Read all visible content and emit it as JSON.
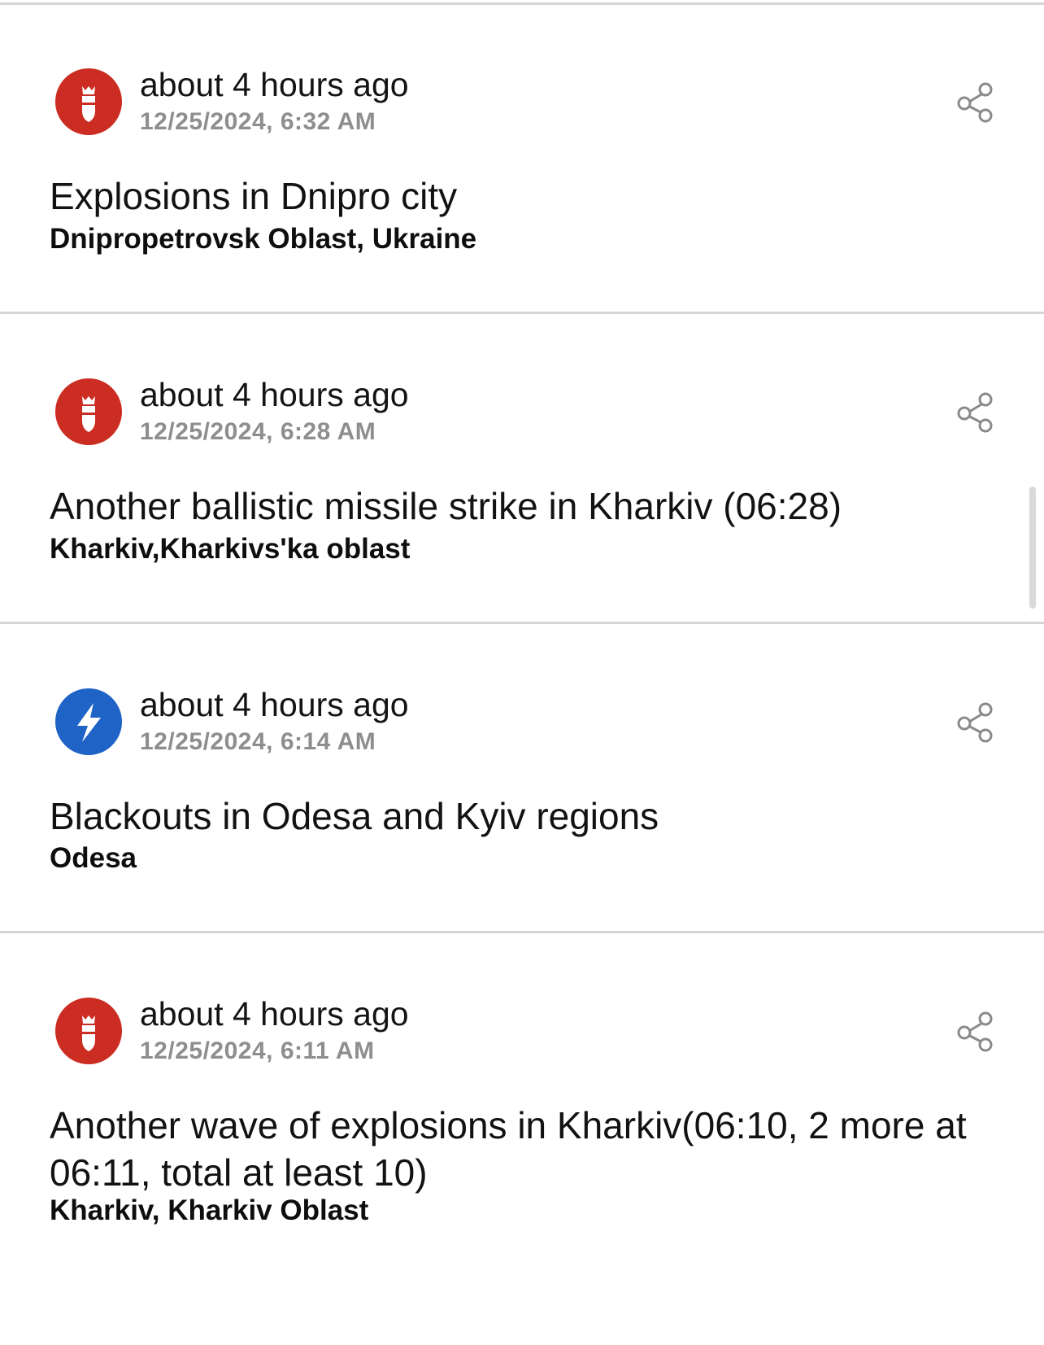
{
  "feed": {
    "items": [
      {
        "category_icon": "bomb-icon",
        "icon_color": "#cc2d22",
        "relative_time": "about 4 hours ago",
        "timestamp": "12/25/2024, 6:32 AM",
        "title": "Explosions in Dnipro city",
        "location": "Dnipropetrovsk Oblast, Ukraine"
      },
      {
        "category_icon": "bomb-icon",
        "icon_color": "#cc2d22",
        "relative_time": "about 4 hours ago",
        "timestamp": "12/25/2024, 6:28 AM",
        "title": "Another ballistic missile strike in Kharkiv (06:28)",
        "location": "Kharkiv,Kharkivs'ka oblast"
      },
      {
        "category_icon": "lightning-bolt-icon",
        "icon_color": "#1f63c6",
        "relative_time": "about 4 hours ago",
        "timestamp": "12/25/2024, 6:14 AM",
        "title": "Blackouts in Odesa and Kyiv regions",
        "location": "Odesa"
      },
      {
        "category_icon": "bomb-icon",
        "icon_color": "#cc2d22",
        "relative_time": "about 4 hours ago",
        "timestamp": "12/25/2024, 6:11 AM",
        "title": "Another wave of explosions in Kharkiv(06:10, 2 more at 06:11, total at least 10)",
        "location": "Kharkiv, Kharkiv Oblast"
      }
    ],
    "share_icon": "share-icon"
  }
}
